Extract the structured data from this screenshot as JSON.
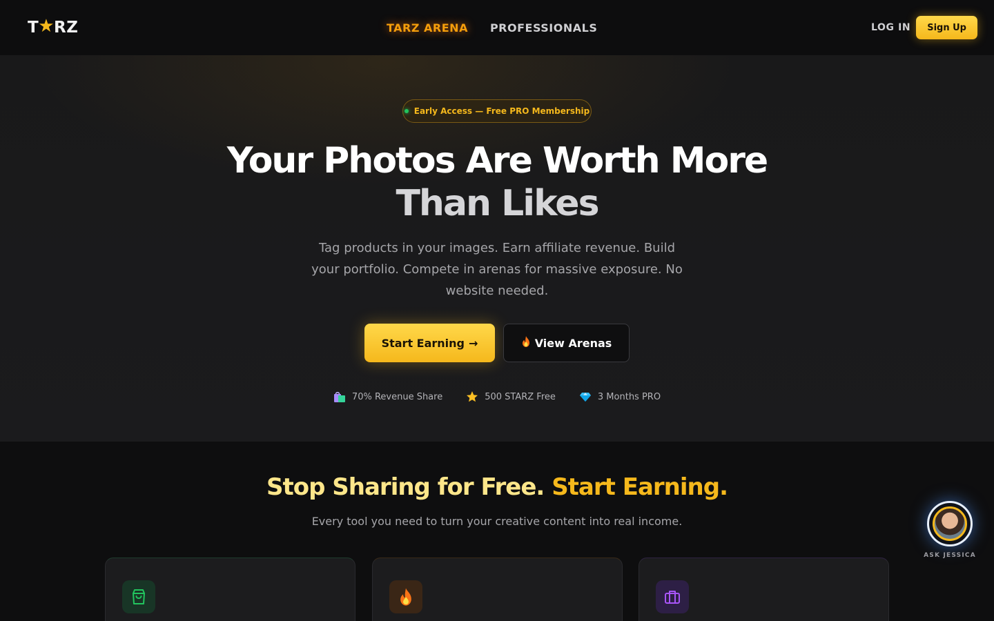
{
  "nav": {
    "logo": {
      "left": "T",
      "star": "★",
      "right": "RZ"
    },
    "links": [
      {
        "label": "TARZ ARENA",
        "active": true
      },
      {
        "label": "PROFESSIONALS",
        "active": false
      }
    ],
    "login_label": "LOG IN",
    "signup_label": "Sign Up"
  },
  "hero": {
    "badge": "Early Access — Free PRO Membership",
    "headline_line1": "Your Photos Are Worth More",
    "headline_line2": "Than Likes",
    "subtext": "Tag products in your images. Earn affiliate revenue. Build your portfolio. Compete in arenas for massive exposure. No website needed.",
    "primary_cta": "Start Earning",
    "primary_cta_arrow": "→",
    "secondary_cta": "View Arenas",
    "perks": [
      {
        "icon": "shopping-bags-icon",
        "label": "70% Revenue Share"
      },
      {
        "icon": "star-icon",
        "label": "500 STARZ Free"
      },
      {
        "icon": "diamond-icon",
        "label": "3 Months PRO"
      }
    ]
  },
  "features": {
    "title_part1": "Stop Sharing for Free.",
    "title_part2": "Start Earning.",
    "subtitle": "Every tool you need to turn your creative content into real income.",
    "cards": [
      {
        "icon": "shopping-bag-icon",
        "accent": "#22c55e"
      },
      {
        "icon": "fire-icon",
        "accent": "#f97316"
      },
      {
        "icon": "briefcase-icon",
        "accent": "#a855f7"
      }
    ]
  },
  "assistant": {
    "label": "ASK JESSICA"
  },
  "colors": {
    "accent": "#f5b81c",
    "nav_active": "#f59e0b",
    "background": "#0e0e0f",
    "hero_background": "#1b1b1d"
  }
}
